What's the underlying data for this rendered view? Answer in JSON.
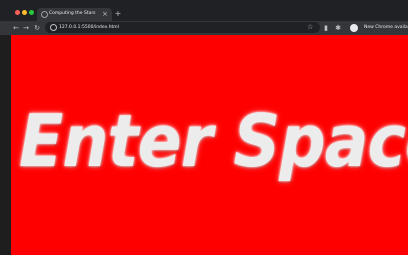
{
  "browser": {
    "tab": {
      "title": "Computing the Stars",
      "close_glyph": "×"
    },
    "new_tab_glyph": "+",
    "url": "127.0.0.1:5500/index.html",
    "update_button": "New Chrome available",
    "icons": {
      "back": "←",
      "forward": "→",
      "reload": "↻",
      "star": "☆",
      "document": "▮",
      "extensions": "✱"
    }
  },
  "page": {
    "headline": "Enter Space",
    "background_color": "#ff0000",
    "text_color": "#ececec"
  }
}
